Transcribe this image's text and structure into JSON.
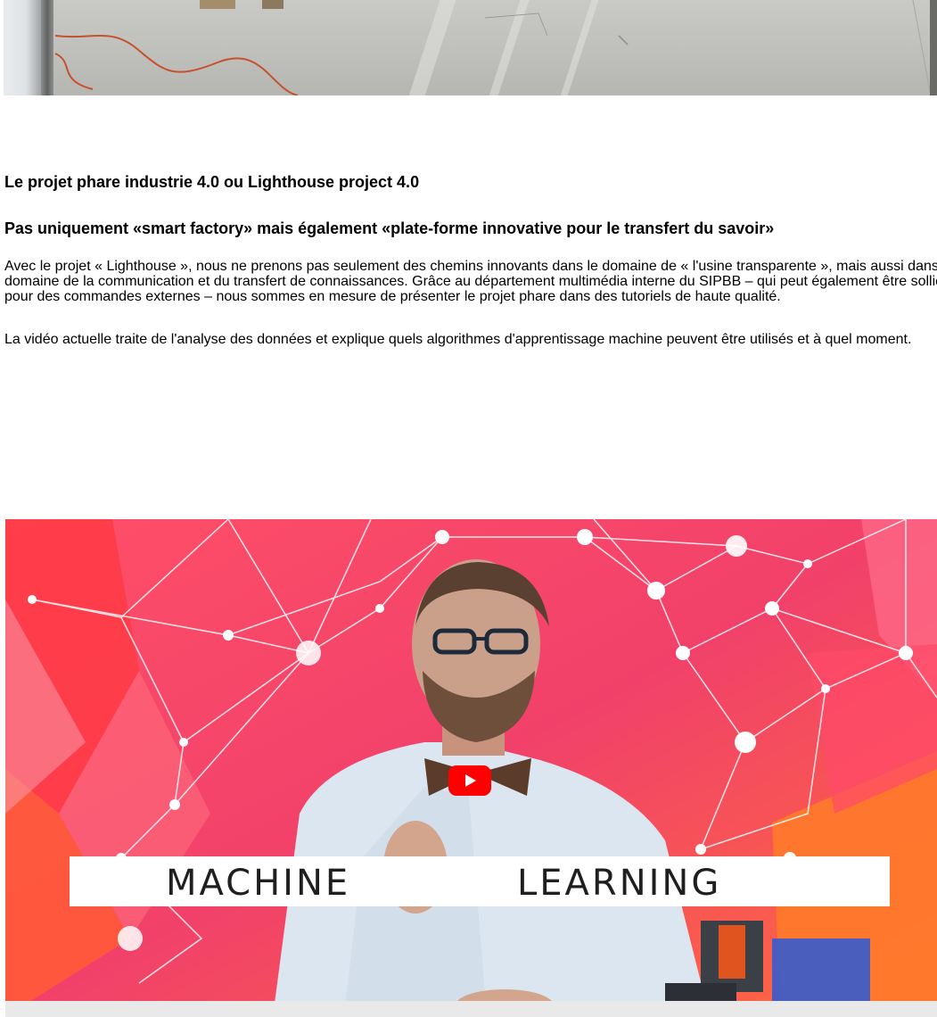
{
  "article": {
    "heading": "Le projet phare industrie 4.0 ou Lighthouse project 4.0",
    "subheading": "Pas uniquement «smart factory» mais également «plate-forme innovative pour le transfert du savoir»",
    "paragraph1": "Avec le projet « Lighthouse », nous ne prenons pas seulement des chemins innovants dans le domaine de « l'usine transparente », mais aussi dans le domaine de la communication et du transfert de connaissances. Grâce au département multimédia interne du SIPBB – qui peut également être sollicité pour des commandes externes – nous sommes en mesure de présenter le projet phare dans des tutoriels de haute qualité.",
    "paragraph2": "La vidéo actuelle traite de l'analyse des données et explique quels algorithmes d'apprentissage machine peuvent être utilisés et à quel moment."
  },
  "video": {
    "banner_left": "MACHINE",
    "banner_right": "LEARNING",
    "play_icon": "youtube-play-icon",
    "colors": {
      "background": "#f3506d",
      "banner": "#ffffff",
      "play": "#ff0000"
    }
  }
}
